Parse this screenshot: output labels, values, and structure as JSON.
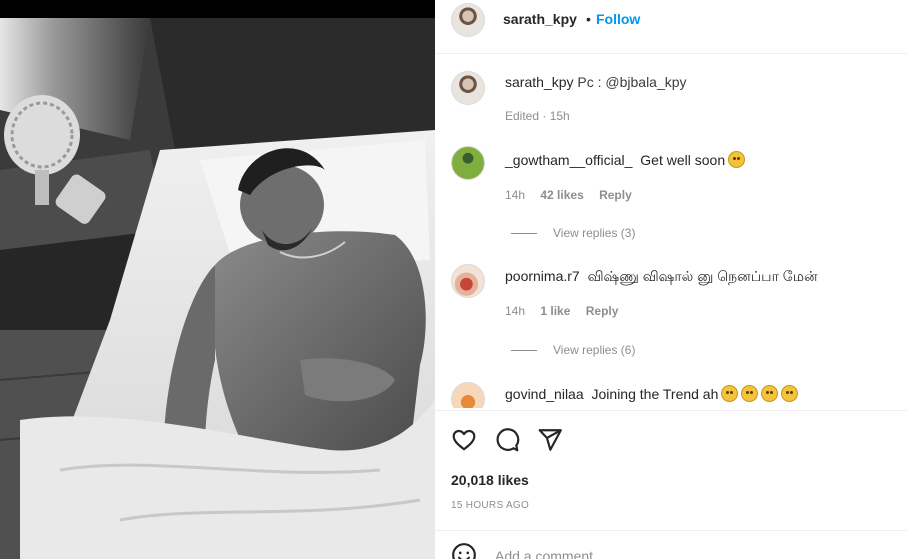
{
  "header": {
    "username": "sarath_kpy",
    "separator": "•",
    "follow_label": "Follow"
  },
  "caption": {
    "username": "sarath_kpy",
    "text": "Pc : @bjbala_kpy",
    "meta": "Edited · 15h"
  },
  "comments": [
    {
      "username": "_gowtham__official_",
      "text": "Get well soon",
      "emoji": "sad-face-emoji",
      "time": "14h",
      "likes": "42 likes",
      "reply": "Reply",
      "view_replies": "View replies (3)"
    },
    {
      "username": "poornima.r7",
      "text": "விஷ்ணு விஷால் னு நெனப்பா மேன்",
      "time": "14h",
      "likes": "1 like",
      "reply": "Reply",
      "view_replies": "View replies (6)"
    },
    {
      "username": "govind_nilaa",
      "text": "Joining the Trend ah",
      "emoji": "laughing-emoji"
    }
  ],
  "actions": {
    "like_icon": "heart-icon",
    "comment_icon": "comment-icon",
    "share_icon": "send-icon"
  },
  "stats": {
    "likes": "20,018 likes",
    "posted": "15 HOURS AGO"
  },
  "add_comment": {
    "placeholder": "Add a comment...",
    "emoji_icon": "smiley-icon"
  },
  "colors": {
    "accent": "#0095f6",
    "secondary_text": "#8e8e8e",
    "primary_text": "#262626"
  }
}
